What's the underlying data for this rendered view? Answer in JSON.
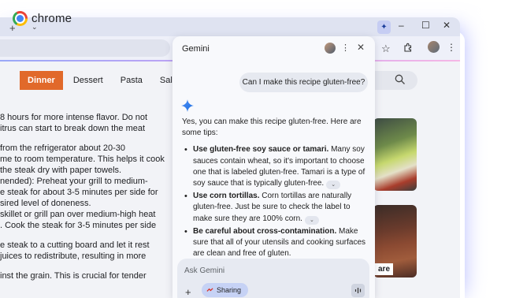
{
  "brand": {
    "name": "chrome"
  },
  "browser": {
    "new_tab_symbol": "+",
    "tab_menu_symbol": "⌄",
    "window_controls": [
      "–",
      "☐",
      "✕"
    ],
    "toolbar_icons": [
      "star-icon",
      "extensions-icon",
      "profile-avatar",
      "more-icon"
    ],
    "accent_gradient": [
      "#9aa8f7",
      "#c7a2f3",
      "#f6b7e5"
    ]
  },
  "page": {
    "categories": [
      {
        "label": "Dinner",
        "active": true
      },
      {
        "label": "Dessert",
        "active": false
      },
      {
        "label": "Pasta",
        "active": false
      },
      {
        "label": "Salad",
        "active": false
      }
    ],
    "active_color": "#e1692a",
    "recipe_lines": [
      "8 hours for more intense flavor. Do not",
      "itrus can start to break down the meat",
      "from the refrigerator about 20-30",
      "me to room temperature. This helps it cook",
      "the steak dry with paper towels.",
      "nended): Preheat your grill to medium-",
      "e steak for about 3-5 minutes per side for",
      "sired level of doneness.",
      "skillet or grill pan over medium-high heat",
      ". Cook the steak for 3-5 minutes per side",
      "e steak to a cutting board and let it rest",
      "juices to redistribute, resulting in more",
      "inst the grain. This is crucial for tender"
    ],
    "image_caption": "are"
  },
  "gemini_panel": {
    "title": "Gemini",
    "user_message": "Can I make this recipe gluten-free?",
    "answer_intro": "Yes, you can make this recipe gluten-free. Here are some tips:",
    "tips": [
      {
        "bold": "Use gluten-free soy sauce or tamari.",
        "text": " Many soy sauces contain wheat, so it's important to choose one that is labeled gluten-free. Tamari is a type of soy sauce that is typically gluten-free.",
        "expandable": true
      },
      {
        "bold": "Use corn tortillas.",
        "text": " Corn tortillas are naturally gluten-free. Just be sure to check the label to make sure they are 100% corn.",
        "expandable": true
      },
      {
        "bold": "Be careful about cross-contamination.",
        "text": " Make sure that all of your utensils and cooking surfaces are clean and free of gluten.",
        "expandable": false
      }
    ],
    "input_placeholder": "Ask Gemini",
    "sharing_label": "Sharing",
    "sharing_color": "#c6d2f5"
  }
}
